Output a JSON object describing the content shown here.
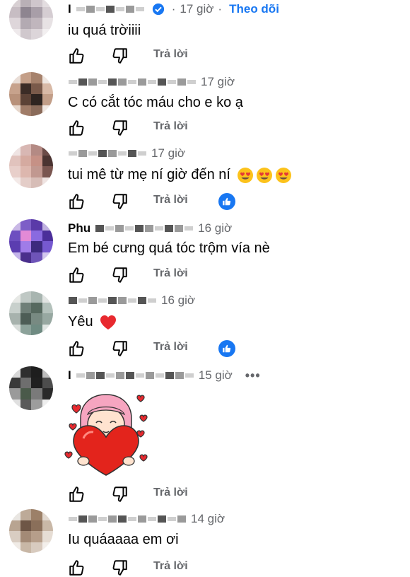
{
  "labels": {
    "reply": "Trả lời",
    "follow": "Theo dõi",
    "more": "•••"
  },
  "comments": [
    {
      "name_initial": "I",
      "time": "17 giờ",
      "text": "iu quá trờiiii",
      "verified": true,
      "follow": true
    },
    {
      "name_initial": "",
      "time": "17 giờ",
      "text": "C có cắt tóc máu cho e ko ạ"
    },
    {
      "name_initial": "",
      "time": "17 giờ",
      "text": "tui mê từ mẹ ní giờ đến ní",
      "emoji": [
        "heart-eyes-emoji",
        "heart-eyes-emoji",
        "heart-eyes-emoji"
      ],
      "reaction": "like"
    },
    {
      "name_initial": "Phu",
      "time": "16 giờ",
      "text": "Em bé cưng quá tóc trộm vía nè"
    },
    {
      "name_initial": "",
      "time": "16 giờ",
      "text": "Yêu",
      "emoji": [
        "red-heart-emoji"
      ],
      "reaction": "like"
    },
    {
      "name_initial": "I",
      "time": "15 giờ",
      "sticker": "girl-hugging-heart-sticker",
      "more": true
    },
    {
      "name_initial": "",
      "time": "14 giờ",
      "text": "Iu quáaaaa em ơi"
    }
  ],
  "colors": {
    "accent": "#1877f2",
    "secondary_text": "#65676b"
  }
}
